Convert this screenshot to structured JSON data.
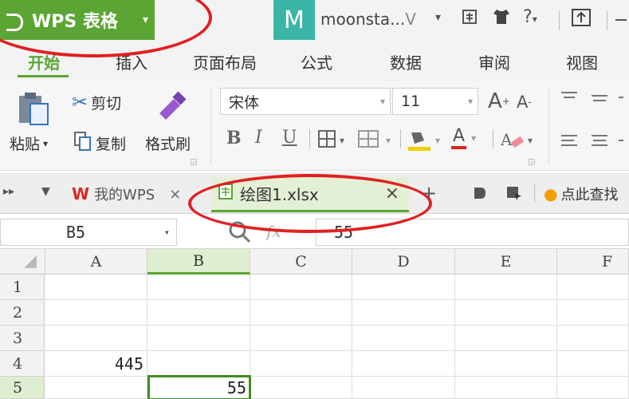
{
  "titlebar": {
    "app_label": "WPS 表格",
    "app_caret": "▾",
    "avatar_letter": "M",
    "user_name": "moonsta...",
    "user_suffix": "V",
    "user_caret": "▾",
    "help_label": "?",
    "icons": [
      "skin-icon",
      "shirt-icon",
      "help-icon",
      "share-icon"
    ]
  },
  "tabs": [
    "开始",
    "插入",
    "页面布局",
    "公式",
    "数据",
    "审阅",
    "视图"
  ],
  "ribbon": {
    "paste": "粘贴",
    "cut": "剪切",
    "copy": "复制",
    "format_painter": "格式刷",
    "font_name": "宋体",
    "font_size": "11",
    "bold": "B",
    "italic": "I",
    "underline": "U",
    "grow": "A",
    "shrink": "A",
    "font_color": "A"
  },
  "docstrip": {
    "my_wps": "我的WPS",
    "active_doc": "绘图1.xlsx",
    "add": "+",
    "search_hint": "点此查找"
  },
  "formula": {
    "cell_ref": "B5",
    "fx": "fx",
    "value": "55"
  },
  "grid": {
    "columns": [
      "A",
      "B",
      "C",
      "D",
      "E",
      "F"
    ],
    "rows": [
      "1",
      "2",
      "3",
      "4",
      "5"
    ],
    "cells": {
      "A4": "445",
      "B5": "55"
    },
    "selected_column": "B",
    "selected_row": "5"
  },
  "colors": {
    "accent": "#5aa533",
    "annotation": "#e02020",
    "avatar": "#3bb6a6"
  }
}
